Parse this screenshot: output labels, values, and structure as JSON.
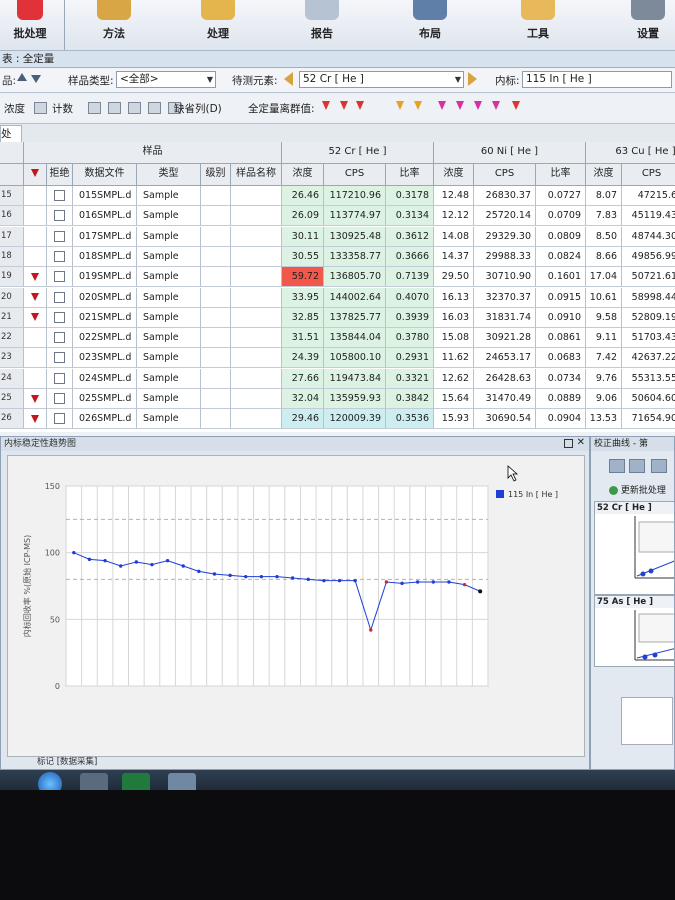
{
  "ribbon": {
    "items": [
      {
        "label": "批处理",
        "icon": "batch-icon"
      },
      {
        "label": "方法",
        "icon": "method-icon"
      },
      {
        "label": "处理",
        "icon": "process-icon"
      },
      {
        "label": "报告",
        "icon": "report-icon"
      },
      {
        "label": "布局",
        "icon": "layout-icon"
      },
      {
        "label": "工具",
        "icon": "tools-icon"
      },
      {
        "label": "设置",
        "icon": "settings-icon"
      }
    ]
  },
  "title": {
    "text": "表 : 全定量"
  },
  "filter": {
    "sample_type_label": "样品类型:",
    "sample_type_value": "<全部>",
    "element_label": "待测元素:",
    "element_value": "52  Cr  [ He ]",
    "istd_label": "内标:",
    "istd_value": "115  In  [ He ]"
  },
  "toolbar": {
    "conc_label": "浓度",
    "count_label": "计数",
    "missing_col_label": "缺省列(D)",
    "fullquant_label": "全定量离群值:"
  },
  "tab": {
    "label": "处理"
  },
  "table": {
    "group_headers": [
      "样品",
      "52  Cr  [ He ]",
      "60  Ni  [ He ]",
      "63  Cu  [ He ]"
    ],
    "columns": [
      "拒绝",
      "数据文件",
      "类型",
      "级别",
      "样品名称",
      "浓度",
      "CPS",
      "比率",
      "浓度",
      "CPS",
      "比率",
      "浓度",
      "CPS"
    ],
    "rows": [
      {
        "n": "15",
        "flag": false,
        "file": "015SMPL.d",
        "type": "Sample",
        "cr_conc": "26.46",
        "cr_cps": "117210.96",
        "cr_ratio": "0.3178",
        "ni_conc": "12.48",
        "ni_cps": "26830.37",
        "ni_ratio": "0.0727",
        "cu_conc": "8.07",
        "cu_cps": "47215.6"
      },
      {
        "n": "16",
        "flag": false,
        "file": "016SMPL.d",
        "type": "Sample",
        "cr_conc": "26.09",
        "cr_cps": "113774.97",
        "cr_ratio": "0.3134",
        "ni_conc": "12.12",
        "ni_cps": "25720.14",
        "ni_ratio": "0.0709",
        "cu_conc": "7.83",
        "cu_cps": "45119.43"
      },
      {
        "n": "17",
        "flag": false,
        "file": "017SMPL.d",
        "type": "Sample",
        "cr_conc": "30.11",
        "cr_cps": "130925.48",
        "cr_ratio": "0.3612",
        "ni_conc": "14.08",
        "ni_cps": "29329.30",
        "ni_ratio": "0.0809",
        "cu_conc": "8.50",
        "cu_cps": "48744.30"
      },
      {
        "n": "18",
        "flag": false,
        "file": "018SMPL.d",
        "type": "Sample",
        "cr_conc": "30.55",
        "cr_cps": "133358.77",
        "cr_ratio": "0.3666",
        "ni_conc": "14.37",
        "ni_cps": "29988.33",
        "ni_ratio": "0.0824",
        "cu_conc": "8.66",
        "cu_cps": "49856.99"
      },
      {
        "n": "19",
        "flag": true,
        "file": "019SMPL.d",
        "type": "Sample",
        "cr_conc": "59.72",
        "cr_cps": "136805.70",
        "cr_ratio": "0.7139",
        "ni_conc": "29.50",
        "ni_cps": "30710.90",
        "ni_ratio": "0.1601",
        "cu_conc": "17.04",
        "cu_cps": "50721.61"
      },
      {
        "n": "20",
        "flag": true,
        "file": "020SMPL.d",
        "type": "Sample",
        "cr_conc": "33.95",
        "cr_cps": "144002.64",
        "cr_ratio": "0.4070",
        "ni_conc": "16.13",
        "ni_cps": "32370.37",
        "ni_ratio": "0.0915",
        "cu_conc": "10.61",
        "cu_cps": "58998.44"
      },
      {
        "n": "21",
        "flag": true,
        "file": "021SMPL.d",
        "type": "Sample",
        "cr_conc": "32.85",
        "cr_cps": "137825.77",
        "cr_ratio": "0.3939",
        "ni_conc": "16.03",
        "ni_cps": "31831.74",
        "ni_ratio": "0.0910",
        "cu_conc": "9.58",
        "cu_cps": "52809.19"
      },
      {
        "n": "22",
        "flag": false,
        "file": "022SMPL.d",
        "type": "Sample",
        "cr_conc": "31.51",
        "cr_cps": "135844.04",
        "cr_ratio": "0.3780",
        "ni_conc": "15.08",
        "ni_cps": "30921.28",
        "ni_ratio": "0.0861",
        "cu_conc": "9.11",
        "cu_cps": "51703.43"
      },
      {
        "n": "23",
        "flag": false,
        "file": "023SMPL.d",
        "type": "Sample",
        "cr_conc": "24.39",
        "cr_cps": "105800.10",
        "cr_ratio": "0.2931",
        "ni_conc": "11.62",
        "ni_cps": "24653.17",
        "ni_ratio": "0.0683",
        "cu_conc": "7.42",
        "cu_cps": "42637.22"
      },
      {
        "n": "24",
        "flag": false,
        "file": "024SMPL.d",
        "type": "Sample",
        "cr_conc": "27.66",
        "cr_cps": "119473.84",
        "cr_ratio": "0.3321",
        "ni_conc": "12.62",
        "ni_cps": "26428.63",
        "ni_ratio": "0.0734",
        "cu_conc": "9.76",
        "cu_cps": "55313.55"
      },
      {
        "n": "25",
        "flag": true,
        "file": "025SMPL.d",
        "type": "Sample",
        "cr_conc": "32.04",
        "cr_cps": "135959.93",
        "cr_ratio": "0.3842",
        "ni_conc": "15.64",
        "ni_cps": "31470.49",
        "ni_ratio": "0.0889",
        "cu_conc": "9.06",
        "cu_cps": "50604.60"
      },
      {
        "n": "26",
        "flag": true,
        "file": "026SMPL.d",
        "type": "Sample",
        "cr_conc": "29.46",
        "cr_cps": "120009.39",
        "cr_ratio": "0.3536",
        "ni_conc": "15.93",
        "ni_cps": "30690.54",
        "ni_ratio": "0.0904",
        "cu_conc": "13.53",
        "cu_cps": "71654.90"
      }
    ]
  },
  "chart_panel": {
    "title": "内标稳定性趋势图",
    "status": "标记  [数据采集]"
  },
  "right_panel": {
    "title": "校正曲线 - 第",
    "update_label": "更新批处理",
    "curve1_header": "52  Cr  [ He ]",
    "curve2_header": "75  As  [ He ]"
  },
  "colors": {
    "series": "#1f3ed8",
    "outlier": "#d8262e",
    "flag": "#c4141c"
  },
  "chart_data": {
    "type": "line",
    "title": "",
    "xlabel": "",
    "ylabel": "内标回收率 %(原始 ICP-MS)",
    "ylim": [
      0,
      150
    ],
    "yticks": [
      0,
      50,
      100,
      150
    ],
    "grid": true,
    "legend_position": "top-right",
    "guide_lines": [
      125,
      80
    ],
    "series": [
      {
        "name": "115  In  [ He ]",
        "values": [
          100,
          95,
          94,
          90,
          93,
          91,
          94,
          90,
          86,
          84,
          83,
          82,
          82,
          82,
          81,
          80,
          79,
          79,
          79,
          42,
          78,
          77,
          78,
          78,
          78,
          76,
          71
        ],
        "outlier_indices": [
          19,
          20,
          25
        ]
      }
    ]
  }
}
